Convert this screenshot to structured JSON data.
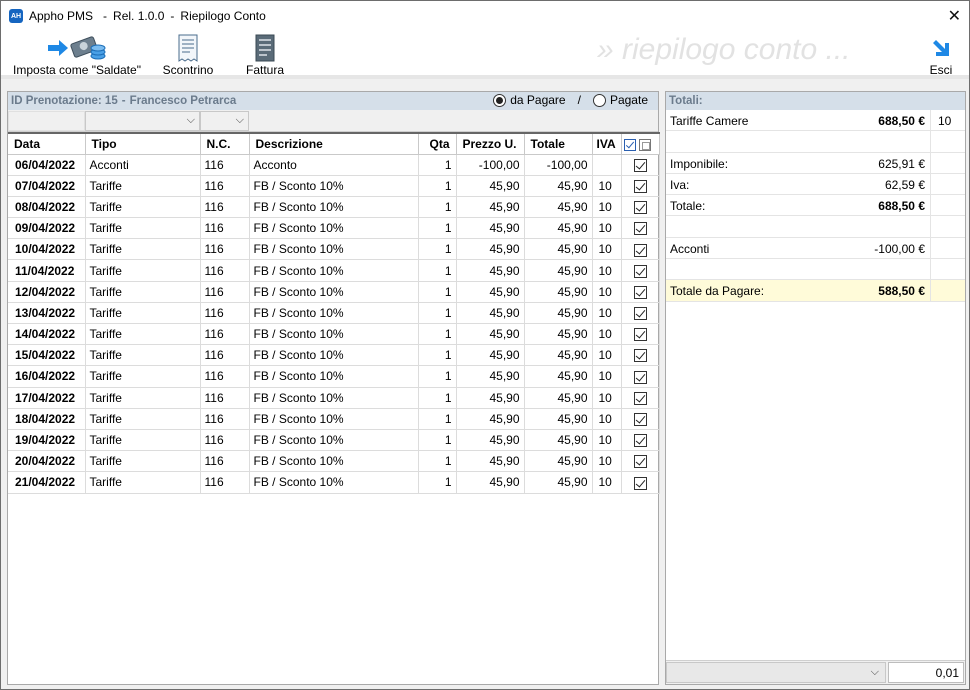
{
  "window": {
    "app_name": "Appho PMS",
    "app_icon": "AH",
    "sep1": "-",
    "release": "Rel. 1.0.0",
    "sep2": "-",
    "title": "Riepilogo Conto",
    "close": "✕"
  },
  "toolbar": {
    "saldate_label": "Imposta come \"Saldate\"",
    "scontrino_label": "Scontrino",
    "fattura_label": "Fattura",
    "esci_label": "Esci",
    "watermark": "» riepilogo conto ..."
  },
  "left": {
    "header_prefix": "ID Prenotazione: 15",
    "header_sep": "-",
    "header_name": "Francesco Petrarca",
    "radio_pagare": "da Pagare",
    "radio_sep": "/",
    "radio_pagate": "Pagate",
    "selected_radio": "da Pagare",
    "columns": [
      "Data",
      "Tipo",
      "N.C.",
      "Descrizione",
      "Qta",
      "Prezzo U.",
      "Totale",
      "IVA"
    ],
    "rows": [
      {
        "data": "06/04/2022",
        "tipo": "Acconti",
        "nc": "116",
        "desc": "Acconto",
        "qta": "1",
        "prezzo": "-100,00",
        "totale": "-100,00",
        "iva": "",
        "checked": true
      },
      {
        "data": "07/04/2022",
        "tipo": "Tariffe",
        "nc": "116",
        "desc": "FB / Sconto 10%",
        "qta": "1",
        "prezzo": "45,90",
        "totale": "45,90",
        "iva": "10",
        "checked": true
      },
      {
        "data": "08/04/2022",
        "tipo": "Tariffe",
        "nc": "116",
        "desc": "FB / Sconto 10%",
        "qta": "1",
        "prezzo": "45,90",
        "totale": "45,90",
        "iva": "10",
        "checked": true
      },
      {
        "data": "09/04/2022",
        "tipo": "Tariffe",
        "nc": "116",
        "desc": "FB / Sconto 10%",
        "qta": "1",
        "prezzo": "45,90",
        "totale": "45,90",
        "iva": "10",
        "checked": true
      },
      {
        "data": "10/04/2022",
        "tipo": "Tariffe",
        "nc": "116",
        "desc": "FB / Sconto 10%",
        "qta": "1",
        "prezzo": "45,90",
        "totale": "45,90",
        "iva": "10",
        "checked": true
      },
      {
        "data": "11/04/2022",
        "tipo": "Tariffe",
        "nc": "116",
        "desc": "FB / Sconto 10%",
        "qta": "1",
        "prezzo": "45,90",
        "totale": "45,90",
        "iva": "10",
        "checked": true
      },
      {
        "data": "12/04/2022",
        "tipo": "Tariffe",
        "nc": "116",
        "desc": "FB / Sconto 10%",
        "qta": "1",
        "prezzo": "45,90",
        "totale": "45,90",
        "iva": "10",
        "checked": true
      },
      {
        "data": "13/04/2022",
        "tipo": "Tariffe",
        "nc": "116",
        "desc": "FB / Sconto 10%",
        "qta": "1",
        "prezzo": "45,90",
        "totale": "45,90",
        "iva": "10",
        "checked": true
      },
      {
        "data": "14/04/2022",
        "tipo": "Tariffe",
        "nc": "116",
        "desc": "FB / Sconto 10%",
        "qta": "1",
        "prezzo": "45,90",
        "totale": "45,90",
        "iva": "10",
        "checked": true
      },
      {
        "data": "15/04/2022",
        "tipo": "Tariffe",
        "nc": "116",
        "desc": "FB / Sconto 10%",
        "qta": "1",
        "prezzo": "45,90",
        "totale": "45,90",
        "iva": "10",
        "checked": true
      },
      {
        "data": "16/04/2022",
        "tipo": "Tariffe",
        "nc": "116",
        "desc": "FB / Sconto 10%",
        "qta": "1",
        "prezzo": "45,90",
        "totale": "45,90",
        "iva": "10",
        "checked": true
      },
      {
        "data": "17/04/2022",
        "tipo": "Tariffe",
        "nc": "116",
        "desc": "FB / Sconto 10%",
        "qta": "1",
        "prezzo": "45,90",
        "totale": "45,90",
        "iva": "10",
        "checked": true
      },
      {
        "data": "18/04/2022",
        "tipo": "Tariffe",
        "nc": "116",
        "desc": "FB / Sconto 10%",
        "qta": "1",
        "prezzo": "45,90",
        "totale": "45,90",
        "iva": "10",
        "checked": true
      },
      {
        "data": "19/04/2022",
        "tipo": "Tariffe",
        "nc": "116",
        "desc": "FB / Sconto 10%",
        "qta": "1",
        "prezzo": "45,90",
        "totale": "45,90",
        "iva": "10",
        "checked": true
      },
      {
        "data": "20/04/2022",
        "tipo": "Tariffe",
        "nc": "116",
        "desc": "FB / Sconto 10%",
        "qta": "1",
        "prezzo": "45,90",
        "totale": "45,90",
        "iva": "10",
        "checked": true
      },
      {
        "data": "21/04/2022",
        "tipo": "Tariffe",
        "nc": "116",
        "desc": "FB / Sconto 10%",
        "qta": "1",
        "prezzo": "45,90",
        "totale": "45,90",
        "iva": "10",
        "checked": true
      }
    ]
  },
  "right": {
    "header": "Totali:",
    "tariffe_label": "Tariffe Camere",
    "tariffe_value": "688,50 €",
    "tariffe_iva": "10",
    "imponibile_label": "Imponibile:",
    "imponibile_value": "625,91 €",
    "iva_label": "Iva:",
    "iva_value": "62,59 €",
    "totale_label": "Totale:",
    "totale_value": "688,50 €",
    "acconti_label": "Acconti",
    "acconti_value": "-100,00 €",
    "da_pagare_label": "Totale da Pagare:",
    "da_pagare_value": "588,50 €",
    "footer_value": "0,01"
  },
  "colors": {
    "panel_header_bg": "#d5dfe9",
    "panel_header_text": "#6b7b8c",
    "highlight": "#fffbd9",
    "accent_blue": "#1e88e5"
  }
}
